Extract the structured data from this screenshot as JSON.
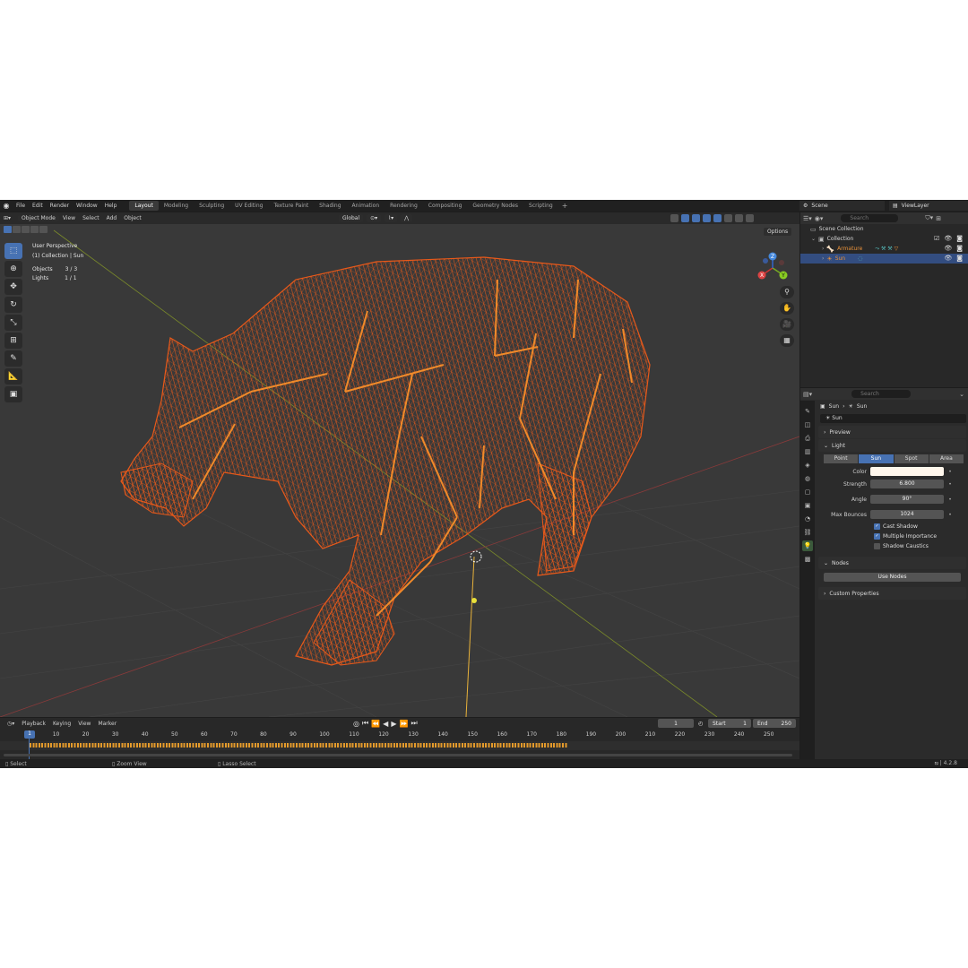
{
  "menu": [
    "File",
    "Edit",
    "Render",
    "Window",
    "Help"
  ],
  "workspaces": [
    "Layout",
    "Modeling",
    "Sculpting",
    "UV Editing",
    "Texture Paint",
    "Shading",
    "Animation",
    "Rendering",
    "Compositing",
    "Geometry Nodes",
    "Scripting"
  ],
  "active_workspace": "Layout",
  "scene": "Scene",
  "view_layer": "ViewLayer",
  "viewport": {
    "mode": "Object Mode",
    "menus": [
      "View",
      "Select",
      "Add",
      "Object"
    ],
    "transform": "Global",
    "perspective": "User Perspective",
    "collection_info": "(1) Collection | Sun",
    "objects_label": "Objects",
    "objects_value": "3 / 3",
    "lights_label": "Lights",
    "lights_value": "1 / 1",
    "options": "Options",
    "gizmo_x": "X",
    "gizmo_y": "Y",
    "gizmo_z": "Z"
  },
  "timeline": {
    "menus": [
      "Playback",
      "Keying",
      "View",
      "Marker"
    ],
    "current_frame": "1",
    "start_label": "Start",
    "start": "1",
    "end_label": "End",
    "end": "250",
    "ticks": [
      "10",
      "20",
      "30",
      "40",
      "50",
      "60",
      "70",
      "80",
      "90",
      "100",
      "110",
      "120",
      "130",
      "140",
      "150",
      "160",
      "170",
      "180",
      "190",
      "200",
      "210",
      "220",
      "230",
      "240",
      "250"
    ]
  },
  "status": {
    "select": "Select",
    "zoom": "Zoom View",
    "lasso": "Lasso Select",
    "version": "4.2.8"
  },
  "outliner": {
    "search_placeholder": "Search",
    "scene_collection": "Scene Collection",
    "collection": "Collection",
    "armature": "Armature",
    "sun": "Sun"
  },
  "properties": {
    "search_placeholder": "Search",
    "crumb_object": "Sun",
    "crumb_data": "Sun",
    "name": "Sun",
    "preview": "Preview",
    "light": "Light",
    "light_types": [
      "Point",
      "Sun",
      "Spot",
      "Area"
    ],
    "active_light_type": "Sun",
    "color_label": "Color",
    "color": "#fff7ec",
    "strength_label": "Strength",
    "strength": "6.800",
    "angle_label": "Angle",
    "angle": "90°",
    "bounces_label": "Max Bounces",
    "bounces": "1024",
    "cast_shadow": "Cast Shadow",
    "multiple_importance": "Multiple Importance",
    "shadow_caustics": "Shadow Caustics",
    "nodes": "Nodes",
    "use_nodes": "Use Nodes",
    "custom_properties": "Custom Properties"
  },
  "colors": {
    "accent": "#4772b3",
    "wire": "#e8591a",
    "bone": "#f08a2a"
  }
}
